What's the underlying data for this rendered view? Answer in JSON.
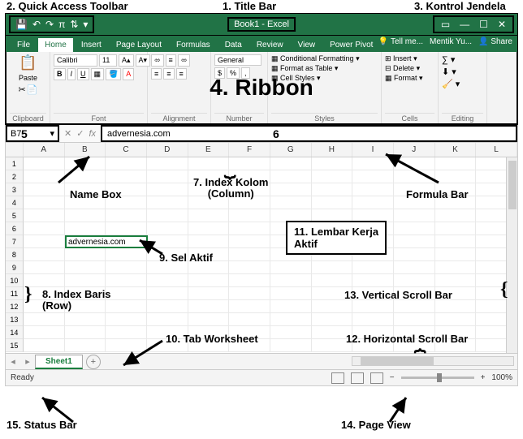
{
  "annotations": {
    "a1": "1. Title Bar",
    "a2": "2. Quick Access Toolbar",
    "a3": "3. Kontrol Jendela",
    "a4": "4. Ribbon",
    "a5_num": "5",
    "a5_label": "Name Box",
    "a6_num": "6",
    "a6_label": "Formula Bar",
    "a7": "7. Index Kolom (Column)",
    "a8": "8. Index Baris (Row)",
    "a9": "9. Sel Aktif",
    "a10": "10. Tab Worksheet",
    "a11": "11. Lembar Kerja Aktif",
    "a12": "12. Horizontal Scroll Bar",
    "a13": "13. Vertical Scroll Bar",
    "a14": "14. Page View",
    "a15": "15. Status Bar"
  },
  "titlebar": {
    "title": "Book1 - Excel",
    "qat": {
      "save": "💾",
      "undo": "↶",
      "redo": "↷",
      "autosum": "π",
      "sort": "⇅"
    },
    "winctrl": {
      "ribbon": "▭",
      "min": "—",
      "max": "☐",
      "close": "✕"
    }
  },
  "tabs": {
    "file": "File",
    "home": "Home",
    "insert": "Insert",
    "pagelayout": "Page Layout",
    "formulas": "Formulas",
    "data": "Data",
    "review": "Review",
    "view": "View",
    "powerpivot": "Power Pivot",
    "tellme": "Tell me...",
    "user": "Mentik Yu...",
    "share": "Share"
  },
  "ribbon": {
    "clipboard": {
      "paste": "Paste",
      "label": "Clipboard"
    },
    "font": {
      "name": "Calibri",
      "size": "11",
      "bold": "B",
      "italic": "I",
      "underline": "U",
      "label": "Font"
    },
    "alignment": {
      "label": "Alignment"
    },
    "number": {
      "format": "General",
      "label": "Number"
    },
    "styles": {
      "cond": "Conditional Formatting",
      "table": "Format as Table",
      "cell": "Cell Styles",
      "label": "Styles"
    },
    "cells": {
      "insert": "Insert",
      "delete": "Delete",
      "format": "Format",
      "label": "Cells"
    },
    "editing": {
      "label": "Editing"
    }
  },
  "fxrow": {
    "namebox": "B7",
    "fx": "fx",
    "formula": "advernesia.com"
  },
  "grid": {
    "cols": [
      "A",
      "B",
      "C",
      "D",
      "E",
      "F",
      "G",
      "H",
      "I",
      "J",
      "K",
      "L"
    ],
    "rowcount": 15,
    "activecell": {
      "ref": "B7",
      "value": "advernesia.com"
    }
  },
  "sheetbar": {
    "sheet1": "Sheet1",
    "add": "+"
  },
  "statusbar": {
    "ready": "Ready",
    "zoom": "100%"
  }
}
